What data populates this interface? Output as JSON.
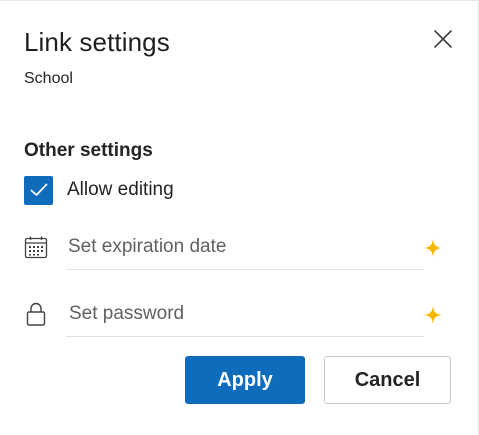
{
  "dialog": {
    "title": "Link settings",
    "subtitle": "School",
    "close_icon": "close-icon"
  },
  "other_settings": {
    "heading": "Other settings",
    "allow_editing": {
      "label": "Allow editing",
      "checked": true
    },
    "expiration": {
      "placeholder": "Set expiration date",
      "value": "",
      "icon": "calendar-icon",
      "badge_icon": "sparkle-icon"
    },
    "password": {
      "placeholder": "Set password",
      "value": "",
      "icon": "lock-icon",
      "badge_icon": "sparkle-icon"
    }
  },
  "actions": {
    "apply_label": "Apply",
    "cancel_label": "Cancel"
  },
  "colors": {
    "accent": "#0f6cbd",
    "sparkle": "#f5b800",
    "text": "#242424"
  }
}
